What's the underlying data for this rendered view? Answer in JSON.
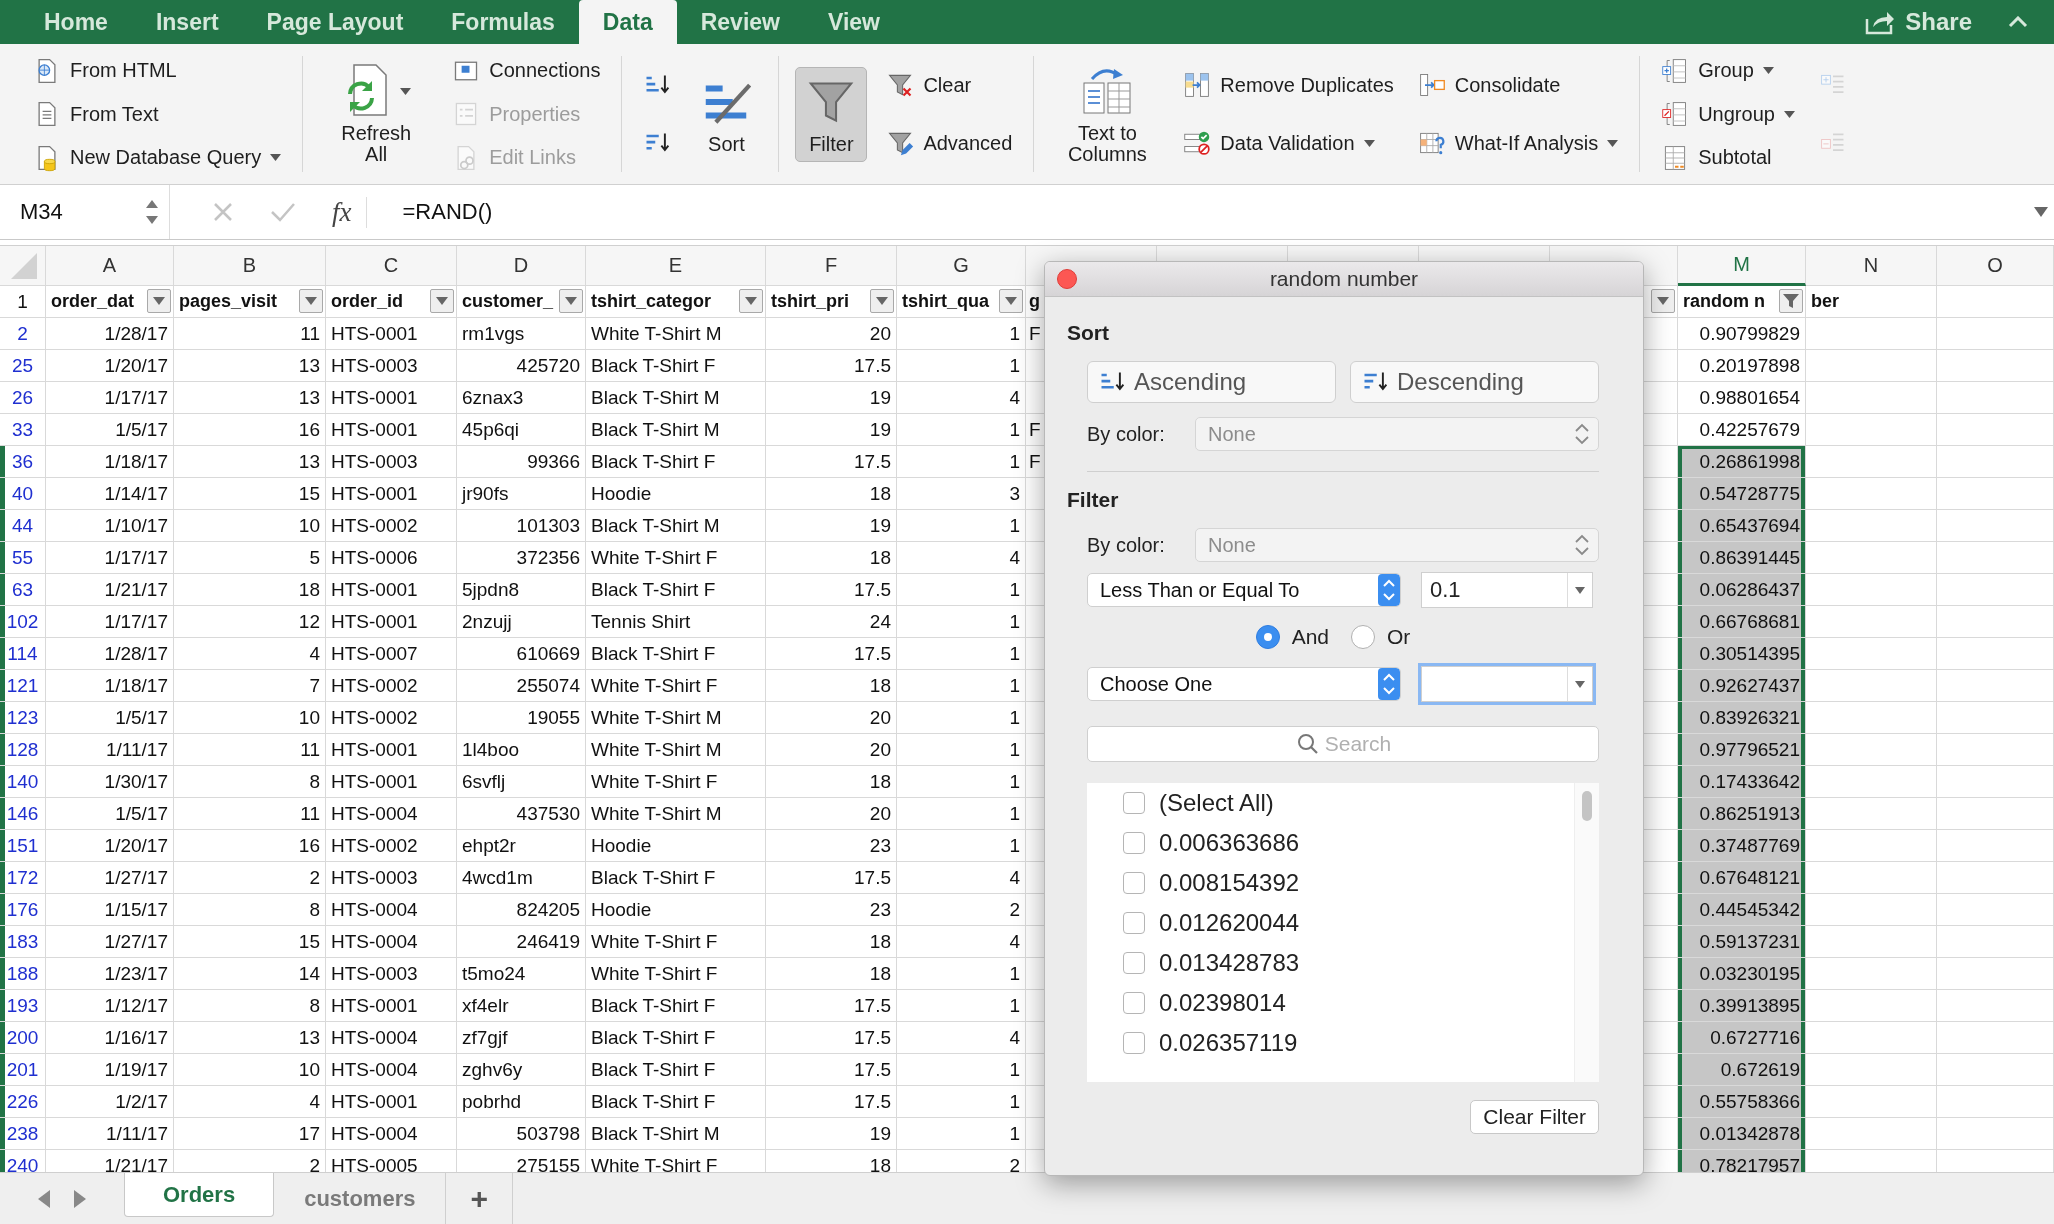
{
  "ribbon_tabs": [
    {
      "label": "Home",
      "selected": false
    },
    {
      "label": "Insert",
      "selected": false
    },
    {
      "label": "Page Layout",
      "selected": false
    },
    {
      "label": "Formulas",
      "selected": false
    },
    {
      "label": "Data",
      "selected": true
    },
    {
      "label": "Review",
      "selected": false
    },
    {
      "label": "View",
      "selected": false
    }
  ],
  "share": {
    "label": "Share"
  },
  "ribbon": {
    "groups": [
      {
        "items": [
          {
            "kind": "small",
            "label": "From HTML",
            "disabled": false,
            "menu": false,
            "on": false
          },
          {
            "kind": "small",
            "label": "From Text",
            "disabled": false,
            "menu": false,
            "on": false
          },
          {
            "kind": "small",
            "label": "New Database Query",
            "disabled": false,
            "menu": true,
            "on": false
          }
        ]
      },
      {
        "items": [
          {
            "kind": "large",
            "label": "Refresh All",
            "disabled": false,
            "menu": true,
            "on": false
          },
          {
            "kind": "small",
            "label": "Connections",
            "disabled": false,
            "menu": false,
            "on": false
          },
          {
            "kind": "small",
            "label": "Properties",
            "disabled": true,
            "menu": false,
            "on": false
          },
          {
            "kind": "small",
            "label": "Edit Links",
            "disabled": true,
            "menu": false,
            "on": false
          }
        ]
      },
      {
        "items": [
          {
            "kind": "icon",
            "disabled": false,
            "menu": false,
            "on": false
          },
          {
            "kind": "icon",
            "disabled": false,
            "menu": false,
            "on": false
          },
          {
            "kind": "large",
            "label": "Sort",
            "disabled": false,
            "menu": false,
            "on": false
          }
        ]
      },
      {
        "items": [
          {
            "kind": "large",
            "label": "Filter",
            "disabled": false,
            "menu": false,
            "on": true
          },
          {
            "kind": "small",
            "label": "Clear",
            "disabled": false,
            "menu": false,
            "on": false
          },
          {
            "kind": "small",
            "label": "Advanced",
            "disabled": false,
            "menu": false,
            "on": false
          }
        ]
      },
      {
        "items": [
          {
            "kind": "large",
            "label": "Text to Columns",
            "disabled": false,
            "menu": false,
            "on": false
          },
          {
            "kind": "small",
            "label": "Remove Duplicates",
            "disabled": false,
            "menu": false,
            "on": false
          },
          {
            "kind": "small",
            "label": "Data Validation",
            "disabled": false,
            "menu": true,
            "on": false
          },
          {
            "kind": "small",
            "label": "Consolidate",
            "disabled": false,
            "menu": false,
            "on": false
          },
          {
            "kind": "small",
            "label": "What-If Analysis",
            "disabled": false,
            "menu": true,
            "on": false
          }
        ]
      },
      {
        "items": [
          {
            "kind": "small",
            "label": "Group",
            "disabled": false,
            "menu": true,
            "on": false
          },
          {
            "kind": "small",
            "label": "Ungroup",
            "disabled": false,
            "menu": true,
            "on": false
          },
          {
            "kind": "small",
            "label": "Subtotal",
            "disabled": false,
            "menu": false,
            "on": false
          },
          {
            "kind": "icon",
            "disabled": true,
            "menu": false,
            "on": false
          },
          {
            "kind": "icon",
            "disabled": true,
            "menu": false,
            "on": false
          }
        ]
      }
    ]
  },
  "formula_bar": {
    "name_box": "M34",
    "function_label": "fx",
    "formula": "=RAND()"
  },
  "sheet": {
    "header_row_number": "1",
    "columns": [
      {
        "letter": "A",
        "header": "order_dat",
        "filter_button": true,
        "filtered": false,
        "selected": false
      },
      {
        "letter": "B",
        "header": "pages_visit",
        "filter_button": true,
        "filtered": false,
        "selected": false
      },
      {
        "letter": "C",
        "header": "order_id",
        "filter_button": true,
        "filtered": false,
        "selected": false
      },
      {
        "letter": "D",
        "header": "customer_",
        "filter_button": true,
        "filtered": false,
        "selected": false
      },
      {
        "letter": "E",
        "header": "tshirt_categor",
        "filter_button": true,
        "filtered": false,
        "selected": false
      },
      {
        "letter": "F",
        "header": "tshirt_pri",
        "filter_button": true,
        "filtered": false,
        "selected": false
      },
      {
        "letter": "G",
        "header": "tshirt_qua",
        "filter_button": true,
        "filtered": false,
        "selected": false
      },
      {
        "header": "g",
        "filter_button": false,
        "selected": false
      },
      {
        "filter_button": false
      },
      {
        "filter_button": false
      },
      {
        "filter_button": false
      },
      {
        "filter_button": true,
        "filtered": false,
        "selected": false
      },
      {
        "letter": "M",
        "header": "random n",
        "filter_button": true,
        "filtered": true,
        "selected": true
      },
      {
        "letter": "N",
        "header": "ber",
        "filter_button": false,
        "selected": false
      },
      {
        "letter": "O",
        "filter_button": false,
        "selected": false
      }
    ],
    "rows": [
      {
        "row": "2",
        "selected": false,
        "cells": [
          "1/28/17",
          "11",
          "HTS-0001",
          "rm1vgs",
          "White T-Shirt M",
          "20",
          "1"
        ],
        "column_h": "F",
        "random_number": "0.90799829"
      },
      {
        "row": "25",
        "selected": false,
        "cells": [
          "1/20/17",
          "13",
          "HTS-0003",
          "425720",
          "Black T-Shirt F",
          "17.5",
          "1"
        ],
        "random_number": "0.20197898"
      },
      {
        "row": "26",
        "selected": false,
        "cells": [
          "1/17/17",
          "13",
          "HTS-0001",
          "6znax3",
          "Black T-Shirt M",
          "19",
          "4"
        ],
        "random_number": "0.98801654"
      },
      {
        "row": "33",
        "selected": false,
        "cells": [
          "1/5/17",
          "16",
          "HTS-0001",
          "45p6qi",
          "Black T-Shirt M",
          "19",
          "1"
        ],
        "column_h": "F",
        "random_number": "0.42257679"
      },
      {
        "row": "36",
        "selected": true,
        "cells": [
          "1/18/17",
          "13",
          "HTS-0003",
          "99366",
          "Black T-Shirt F",
          "17.5",
          "1"
        ],
        "column_h": "F",
        "random_number": "0.26861998"
      },
      {
        "row": "40",
        "selected": true,
        "cells": [
          "1/14/17",
          "15",
          "HTS-0001",
          "jr90fs",
          "Hoodie",
          "18",
          "3"
        ],
        "random_number": "0.54728775"
      },
      {
        "row": "44",
        "selected": true,
        "cells": [
          "1/10/17",
          "10",
          "HTS-0002",
          "101303",
          "Black T-Shirt M",
          "19",
          "1"
        ],
        "random_number": "0.65437694"
      },
      {
        "row": "55",
        "selected": true,
        "cells": [
          "1/17/17",
          "5",
          "HTS-0006",
          "372356",
          "White T-Shirt F",
          "18",
          "4"
        ],
        "random_number": "0.86391445"
      },
      {
        "row": "63",
        "selected": true,
        "cells": [
          "1/21/17",
          "18",
          "HTS-0001",
          "5jpdn8",
          "Black T-Shirt F",
          "17.5",
          "1"
        ],
        "random_number": "0.06286437"
      },
      {
        "row": "102",
        "selected": true,
        "cells": [
          "1/17/17",
          "12",
          "HTS-0001",
          "2nzujj",
          "Tennis Shirt",
          "24",
          "1"
        ],
        "random_number": "0.66768681"
      },
      {
        "row": "114",
        "selected": true,
        "cells": [
          "1/28/17",
          "4",
          "HTS-0007",
          "610669",
          "Black T-Shirt F",
          "17.5",
          "1"
        ],
        "random_number": "0.30514395"
      },
      {
        "row": "121",
        "selected": true,
        "cells": [
          "1/18/17",
          "7",
          "HTS-0002",
          "255074",
          "White T-Shirt F",
          "18",
          "1"
        ],
        "random_number": "0.92627437"
      },
      {
        "row": "123",
        "selected": true,
        "cells": [
          "1/5/17",
          "10",
          "HTS-0002",
          "19055",
          "White T-Shirt M",
          "20",
          "1"
        ],
        "random_number": "0.83926321"
      },
      {
        "row": "128",
        "selected": true,
        "cells": [
          "1/11/17",
          "11",
          "HTS-0001",
          "1l4boo",
          "White T-Shirt M",
          "20",
          "1"
        ],
        "random_number": "0.97796521"
      },
      {
        "row": "140",
        "selected": true,
        "cells": [
          "1/30/17",
          "8",
          "HTS-0001",
          "6svflj",
          "White T-Shirt F",
          "18",
          "1"
        ],
        "random_number": "0.17433642"
      },
      {
        "row": "146",
        "selected": true,
        "cells": [
          "1/5/17",
          "11",
          "HTS-0004",
          "437530",
          "White T-Shirt M",
          "20",
          "1"
        ],
        "random_number": "0.86251913"
      },
      {
        "row": "151",
        "selected": true,
        "cells": [
          "1/20/17",
          "16",
          "HTS-0002",
          "ehpt2r",
          "Hoodie",
          "23",
          "1"
        ],
        "random_number": "0.37487769"
      },
      {
        "row": "172",
        "selected": true,
        "cells": [
          "1/27/17",
          "2",
          "HTS-0003",
          "4wcd1m",
          "Black T-Shirt F",
          "17.5",
          "4"
        ],
        "random_number": "0.67648121"
      },
      {
        "row": "176",
        "selected": true,
        "cells": [
          "1/15/17",
          "8",
          "HTS-0004",
          "824205",
          "Hoodie",
          "23",
          "2"
        ],
        "random_number": "0.44545342"
      },
      {
        "row": "183",
        "selected": true,
        "cells": [
          "1/27/17",
          "15",
          "HTS-0004",
          "246419",
          "White T-Shirt F",
          "18",
          "4"
        ],
        "random_number": "0.59137231"
      },
      {
        "row": "188",
        "selected": true,
        "cells": [
          "1/23/17",
          "14",
          "HTS-0003",
          "t5mo24",
          "White T-Shirt F",
          "18",
          "1"
        ],
        "random_number": "0.03230195"
      },
      {
        "row": "193",
        "selected": true,
        "cells": [
          "1/12/17",
          "8",
          "HTS-0001",
          "xf4elr",
          "Black T-Shirt F",
          "17.5",
          "1"
        ],
        "random_number": "0.39913895"
      },
      {
        "row": "200",
        "selected": true,
        "cells": [
          "1/16/17",
          "13",
          "HTS-0004",
          "zf7gjf",
          "Black T-Shirt F",
          "17.5",
          "4"
        ],
        "random_number": "0.6727716"
      },
      {
        "row": "201",
        "selected": true,
        "cells": [
          "1/19/17",
          "10",
          "HTS-0004",
          "zghv6y",
          "Black T-Shirt F",
          "17.5",
          "1"
        ],
        "random_number": "0.672619"
      },
      {
        "row": "226",
        "selected": true,
        "cells": [
          "1/2/17",
          "4",
          "HTS-0001",
          "pobrhd",
          "Black T-Shirt F",
          "17.5",
          "1"
        ],
        "random_number": "0.55758366"
      },
      {
        "row": "238",
        "selected": true,
        "cells": [
          "1/11/17",
          "17",
          "HTS-0004",
          "503798",
          "Black T-Shirt M",
          "19",
          "1"
        ],
        "random_number": "0.01342878"
      },
      {
        "row": "240",
        "selected": true,
        "cells": [
          "1/21/17",
          "2",
          "HTS-0005",
          "275155",
          "White T-Shirt F",
          "18",
          "2"
        ],
        "random_number": "0.78217957"
      }
    ]
  },
  "sheet_tabs": {
    "tabs": [
      {
        "label": "Orders",
        "selected": true
      },
      {
        "label": "customers",
        "selected": false
      }
    ],
    "add_label": "+"
  },
  "filter_dialog": {
    "title": "random number",
    "sort": {
      "heading": "Sort",
      "ascending": "Ascending",
      "descending": "Descending",
      "by_color_label": "By color:",
      "by_color_value": "None"
    },
    "filter": {
      "heading": "Filter",
      "by_color_label": "By color:",
      "by_color_value": "None",
      "condition_1": {
        "operator": "Less Than or Equal To",
        "value": "0.1",
        "focused": false
      },
      "joins": [
        {
          "label": "And",
          "selected": true
        },
        {
          "label": "Or",
          "selected": false
        }
      ],
      "condition_2": {
        "operator": "Choose One",
        "focused": true
      },
      "search": {
        "placeholder": "Search"
      },
      "values": [
        {
          "label": "(Select All)",
          "checked": false
        },
        {
          "label": "0.006363686",
          "checked": false
        },
        {
          "label": "0.008154392",
          "checked": false
        },
        {
          "label": "0.012620044",
          "checked": false
        },
        {
          "label": "0.013428783",
          "checked": false
        },
        {
          "label": "0.02398014",
          "checked": false
        },
        {
          "label": "0.026357119",
          "checked": false
        }
      ],
      "clear_button": "Clear Filter"
    }
  }
}
